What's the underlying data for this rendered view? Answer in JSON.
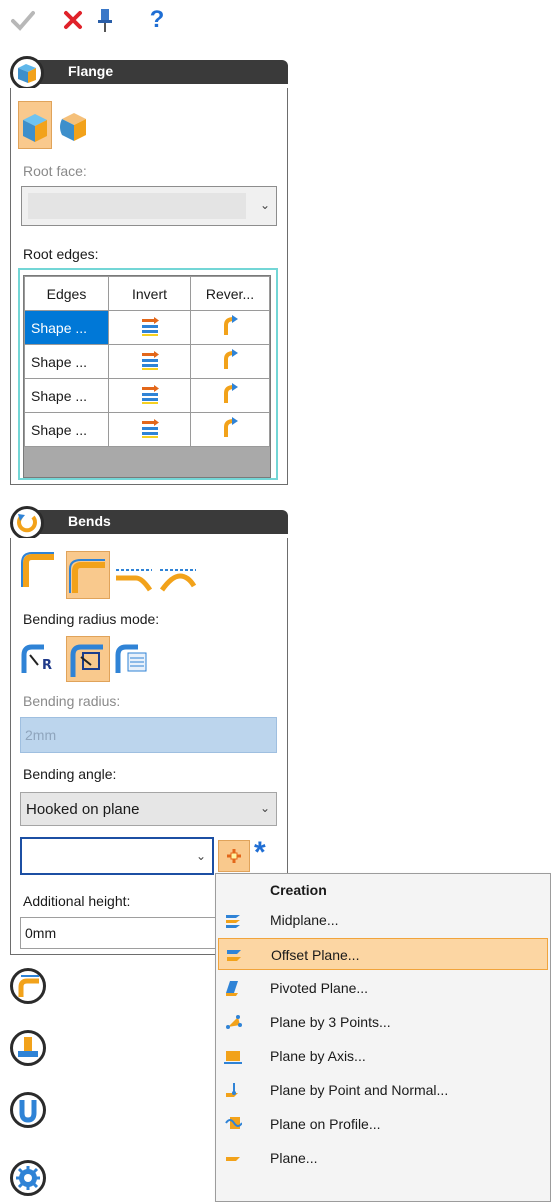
{
  "toolbar": {
    "icons": [
      "checkmark-icon",
      "close-icon",
      "pin-icon",
      "help-icon"
    ],
    "help_glyph": "?"
  },
  "flange": {
    "title": "Flange",
    "root_face_label": "Root face:",
    "root_face_value": "",
    "root_edges_label": "Root edges:",
    "columns": [
      "Edges",
      "Invert",
      "Rever..."
    ],
    "rows": [
      {
        "name": "Shape ...",
        "selected": true
      },
      {
        "name": "Shape ...",
        "selected": false
      },
      {
        "name": "Shape ...",
        "selected": false
      },
      {
        "name": "Shape ...",
        "selected": false
      }
    ]
  },
  "bends": {
    "title": "Bends",
    "radius_mode_label": "Bending radius mode:",
    "radius_label": "Bending radius:",
    "radius_value": "2mm",
    "angle_label": "Bending angle:",
    "angle_value": "Hooked on plane",
    "plane_value": "",
    "additional_height_label": "Additional height:",
    "additional_height_value": "0mm",
    "asterisk": "*"
  },
  "menu": {
    "header": "Creation",
    "items": [
      {
        "label": "Midplane...",
        "icon": "midplane-icon"
      },
      {
        "label": "Offset Plane...",
        "icon": "offset-plane-icon",
        "highlighted": true
      },
      {
        "label": "Pivoted Plane...",
        "icon": "pivoted-plane-icon"
      },
      {
        "label": "Plane by 3 Points...",
        "icon": "plane-3-points-icon"
      },
      {
        "label": "Plane by Axis...",
        "icon": "plane-by-axis-icon"
      },
      {
        "label": "Plane by Point and Normal...",
        "icon": "plane-point-normal-icon"
      },
      {
        "label": "Plane on Profile...",
        "icon": "plane-on-profile-icon"
      },
      {
        "label": "Plane...",
        "icon": "plane-icon"
      }
    ]
  },
  "colors": {
    "accent_blue": "#0078d7",
    "menu_highlight": "#fcd6a3",
    "header_dark": "#3a3a3a",
    "toggle_active": "#f9c98d"
  }
}
